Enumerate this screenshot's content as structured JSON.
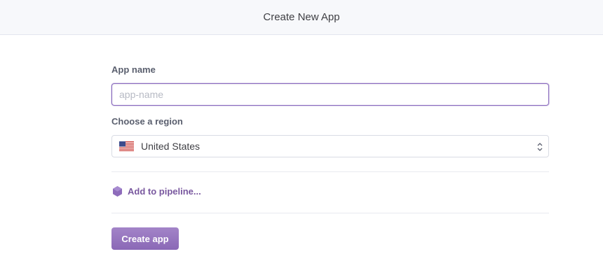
{
  "header": {
    "title": "Create New App"
  },
  "form": {
    "app_name_label": "App name",
    "app_name_value": "",
    "app_name_placeholder": "app-name",
    "region_label": "Choose a region",
    "region_value": "United States",
    "region_icon": "us-flag-icon",
    "pipeline_link": "Add to pipeline...",
    "pipeline_icon": "pipeline-hexagon-icon",
    "submit_label": "Create app"
  },
  "colors": {
    "accent": "#79589f",
    "button": "#967bc0",
    "focus_border": "#8a6bbf",
    "header_bg": "#f7f8fb"
  }
}
